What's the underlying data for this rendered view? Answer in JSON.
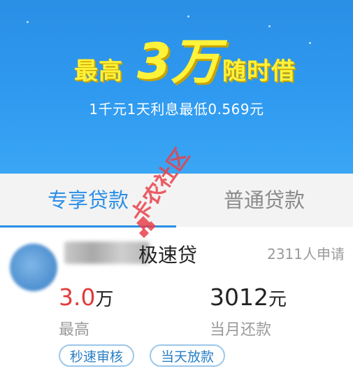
{
  "banner": {
    "headline_prefix": "最高",
    "headline_amount": "3万",
    "headline_suffix": "随时借",
    "subline": "1千元1天利息最低0.569元"
  },
  "tabs": [
    {
      "label": "专享贷款",
      "active": true
    },
    {
      "label": "普通贷款",
      "active": false
    }
  ],
  "loan_card": {
    "name_visible": "极速贷",
    "applicants": "2311人申请",
    "max_amount_value": "3.0",
    "max_amount_unit": "万",
    "max_amount_label": "最高",
    "monthly_repay_value": "3012",
    "monthly_repay_unit": "元",
    "monthly_repay_label": "当月还款",
    "badges": [
      "秒速审核",
      "当天放款"
    ]
  },
  "watermark": {
    "text": "卡农社区"
  },
  "colors": {
    "accent": "#2a8fe6",
    "headline": "#fff23a",
    "amount_red": "#e33a3a",
    "muted": "#9a9a9a"
  }
}
